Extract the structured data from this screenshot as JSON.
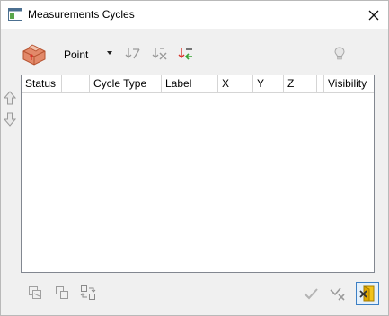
{
  "window": {
    "title": "Measurements Cycles"
  },
  "toolbar": {
    "mode_value": "Point"
  },
  "grid": {
    "columns": [
      "Status",
      "",
      "Cycle Type",
      "Label",
      "X",
      "Y",
      "Z",
      "",
      "Visibility"
    ],
    "rows": []
  },
  "icons": {
    "title": "window-icon",
    "close": "close-icon",
    "part": "part-cube-icon",
    "dropdown": "chevron-down-icon",
    "add": "add-cycle-icon",
    "remove": "remove-cycle-icon",
    "import": "import-cycle-icon",
    "hint": "lightbulb-icon",
    "up": "arrow-up-icon",
    "down": "arrow-down-icon",
    "check": "check-icon",
    "cancel": "cancel-icon",
    "exit": "exit-icon"
  },
  "colors": {
    "accent_red": "#d8342a",
    "accent_green": "#39a535",
    "cube": "#e2896a",
    "exit_yellow": "#f2c21a"
  }
}
